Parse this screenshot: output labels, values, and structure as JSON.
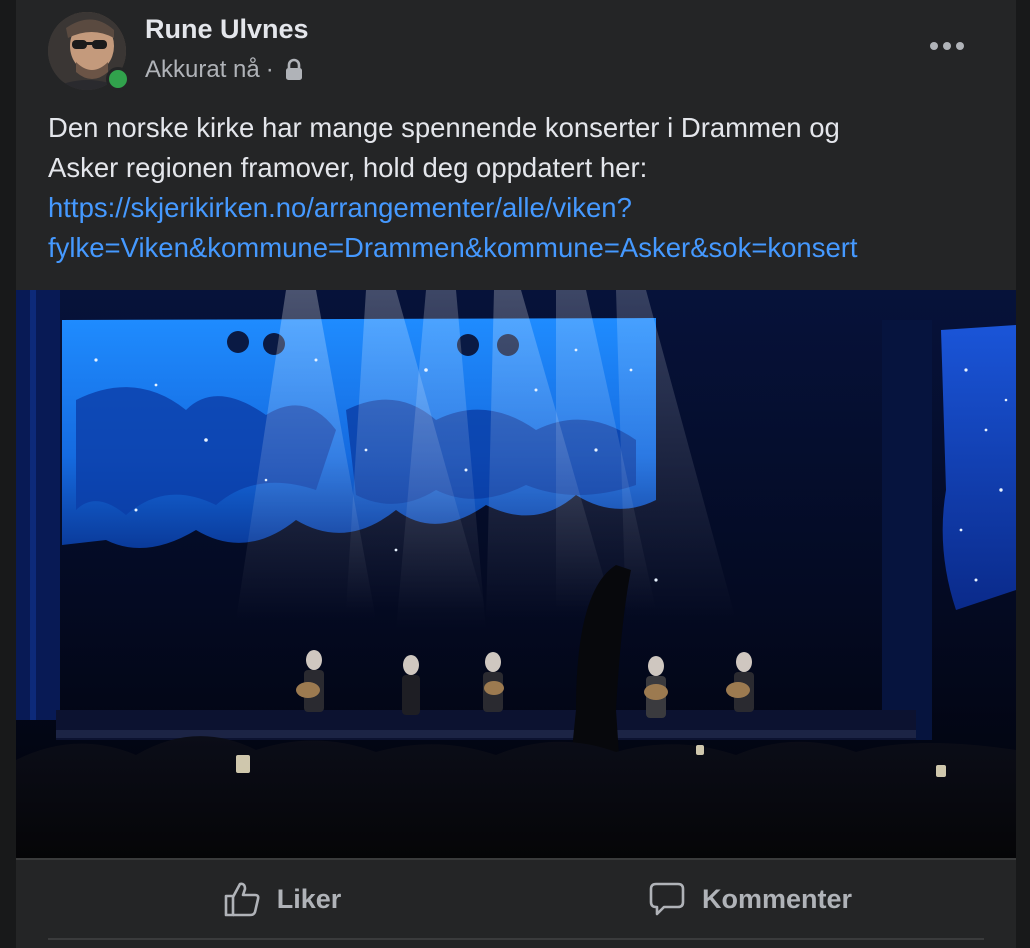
{
  "post": {
    "author": "Rune Ulvnes",
    "timestamp": "Akkurat nå",
    "separator": "·",
    "privacy_icon": "lock-icon",
    "more_icon": "more-options-icon",
    "online_status_color": "#31a24c",
    "text_lines": [
      "Den norske kirke har mange spennende konserter i Drammen og",
      "Asker regionen framover, hold deg oppdatert her:"
    ],
    "link_lines": [
      "https://skjerikirken.no/arrangementer/alle/viken?",
      "fylke=Viken&kommune=Drammen&kommune=Asker&sok=konsert"
    ],
    "link_color": "#4599ff",
    "photo_icon": "concert-stage-photo"
  },
  "actions": {
    "like_label": "Liker",
    "like_icon": "thumbs-up-icon",
    "comment_label": "Kommenter",
    "comment_icon": "comment-icon"
  }
}
